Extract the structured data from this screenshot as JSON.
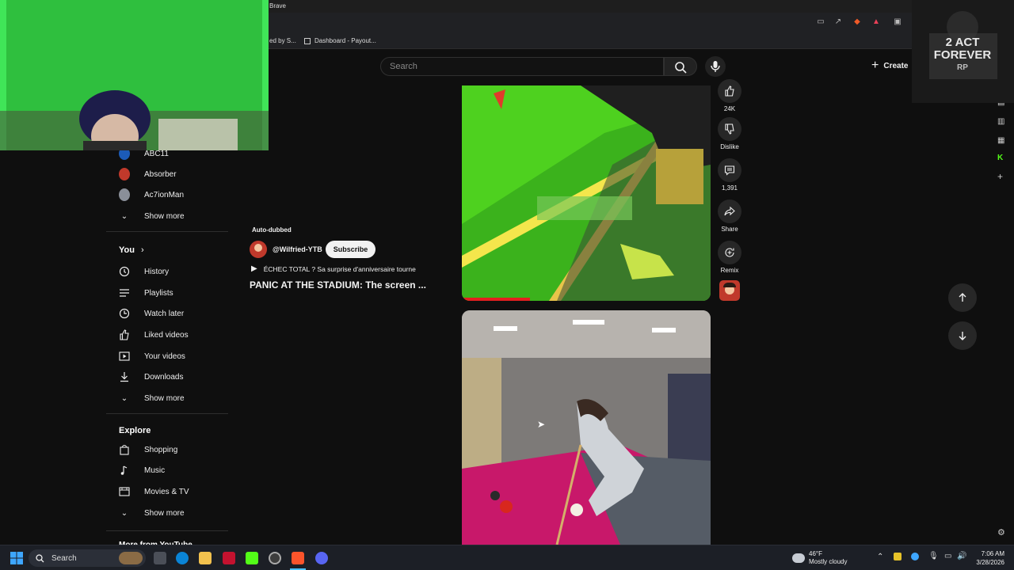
{
  "browser": {
    "title": "Brave",
    "bookmarks": [
      {
        "label": "ed by S..."
      },
      {
        "label": "Dashboard - Payout..."
      }
    ]
  },
  "youtube": {
    "search_placeholder": "Search",
    "create_label": "Create"
  },
  "sidebar": {
    "subscriptions": [
      {
        "label": "ABC11"
      },
      {
        "label": "Absorber"
      },
      {
        "label": "Ac7ionMan"
      }
    ],
    "subs_show_more": "Show more",
    "you_header": "You",
    "you_items": [
      {
        "label": "History",
        "icon": "history-icon"
      },
      {
        "label": "Playlists",
        "icon": "playlists-icon"
      },
      {
        "label": "Watch later",
        "icon": "clock-icon"
      },
      {
        "label": "Liked videos",
        "icon": "thumbs-up-icon"
      },
      {
        "label": "Your videos",
        "icon": "play-square-icon"
      },
      {
        "label": "Downloads",
        "icon": "download-icon"
      }
    ],
    "you_show_more": "Show more",
    "explore_header": "Explore",
    "explore_items": [
      {
        "label": "Shopping",
        "icon": "shopping-bag-icon"
      },
      {
        "label": "Music",
        "icon": "music-note-icon"
      },
      {
        "label": "Movies & TV",
        "icon": "film-icon"
      }
    ],
    "explore_show_more": "Show more",
    "more_from": "More from YouTube"
  },
  "short": {
    "badge": "Auto-dubbed",
    "channel": "@Wilfried-YTB",
    "subscribe_label": "Subscribe",
    "playlist_line": "ÉCHEC TOTAL ? Sa surprise d'anniversaire tourne",
    "title": "PANIC AT THE STADIUM: The screen ..."
  },
  "actions": {
    "like_count": "24K",
    "dislike_label": "Dislike",
    "comment_count": "1,391",
    "share_label": "Share",
    "remix_label": "Remix"
  },
  "taskbar": {
    "search_label": "Search",
    "weather_temp": "46°F",
    "weather_desc": "Mostly cloudy",
    "time": "7:06 AM",
    "date": "3/28/2026"
  },
  "logo": {
    "text": "2 ACT FOREVER RP"
  },
  "colors": {
    "yt_bg": "#0f0f0f",
    "green_screen": "#2fbf3e",
    "pool_felt": "#c8186a"
  }
}
